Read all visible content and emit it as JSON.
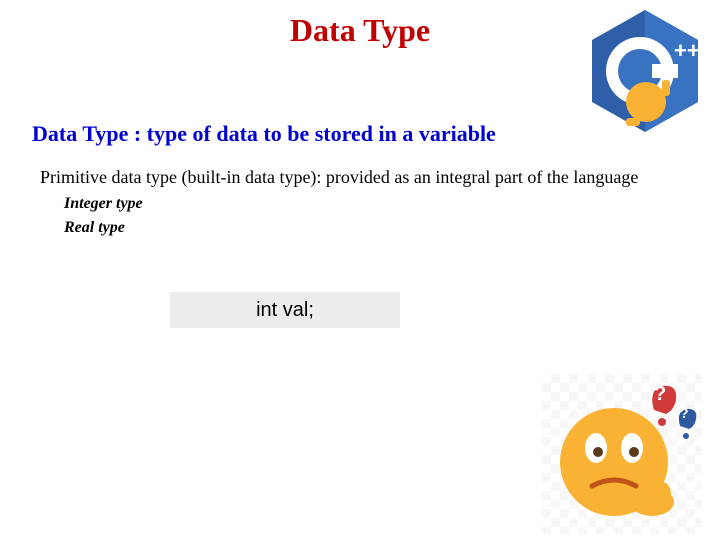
{
  "title": "Data Type",
  "subtitle": "Data Type : type of data to be stored in a variable",
  "bodyText": "Primitive data type (built-in data type): provided as an integral part of the language",
  "subItems": {
    "integer": "Integer type",
    "real": "Real type"
  },
  "codeBox": "int val;",
  "cppBadge": "++",
  "emojiQuestions": {
    "q1": "?",
    "q2": "?"
  }
}
